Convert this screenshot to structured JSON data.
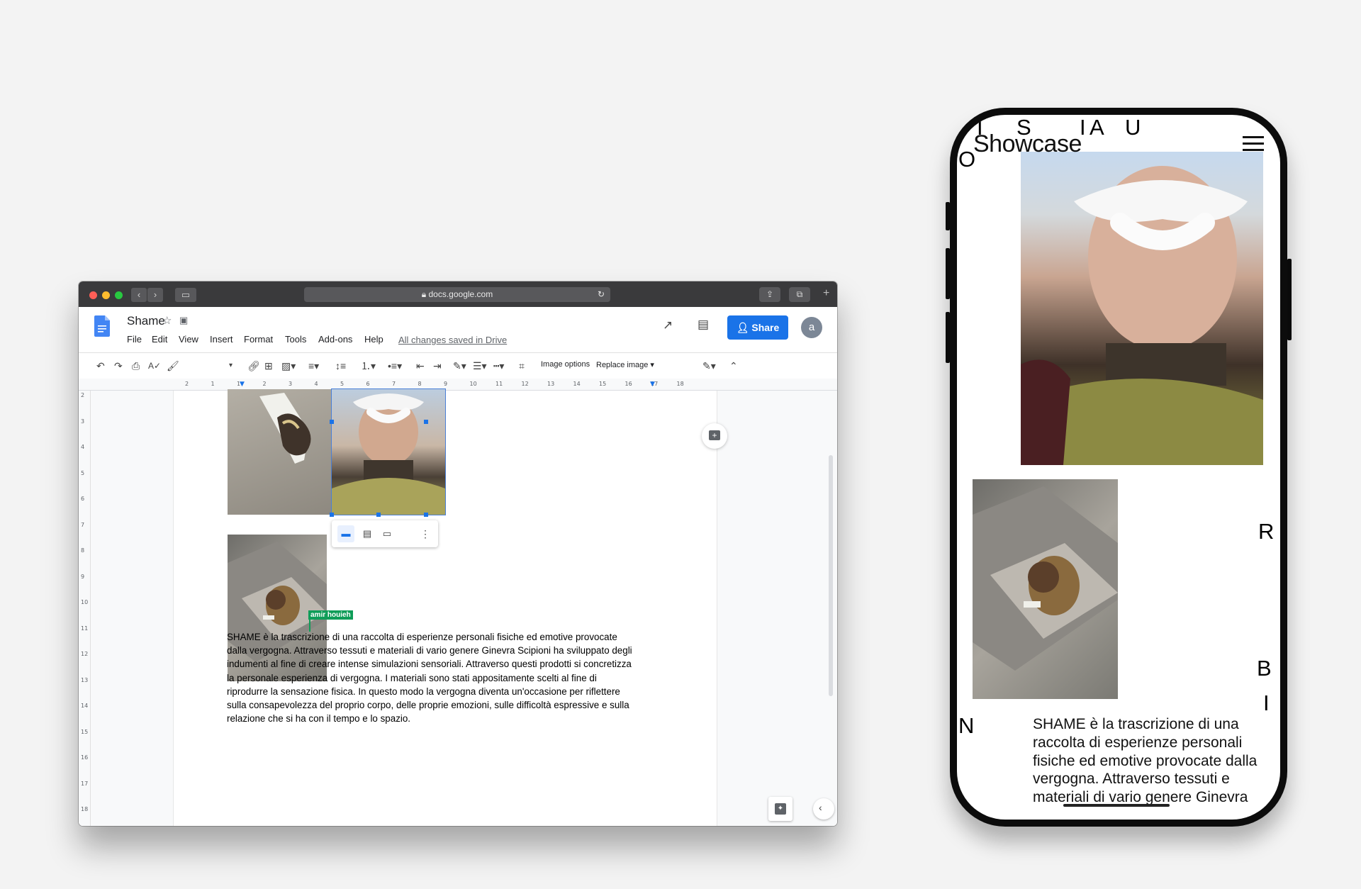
{
  "browser": {
    "url": "docs.google.com",
    "traffic_lights": [
      "#ff5f57",
      "#febc2e",
      "#28c840"
    ]
  },
  "docs": {
    "title": "Shame",
    "menu": [
      "File",
      "Edit",
      "View",
      "Insert",
      "Format",
      "Tools",
      "Add-ons",
      "Help"
    ],
    "saved_status": "All changes saved in Drive",
    "share_label": "Share",
    "avatar_letter": "a",
    "toolbar": {
      "image_options": "Image options",
      "replace_image": "Replace image"
    },
    "ruler_labels": [
      "2",
      "1",
      "1",
      "2",
      "3",
      "4",
      "5",
      "6",
      "7",
      "8",
      "9",
      "10",
      "11",
      "12",
      "13",
      "14",
      "15",
      "16",
      "17",
      "18"
    ],
    "vertical_ruler_labels": [
      "2",
      "3",
      "4",
      "5",
      "6",
      "7",
      "8",
      "9",
      "10",
      "11",
      "12",
      "13",
      "14",
      "15",
      "16",
      "17",
      "18"
    ],
    "cursor_user": "amir houieh",
    "paragraph": "SHAME è la trascrizione di una raccolta di esperienze personali fisiche ed emotive provocate dalla vergogna. Attraverso tessuti e materiali di vario genere Ginevra Scipioni ha sviluppato degli indumenti al fine di creare intense simulazioni sensoriali.  Attraverso questi prodotti si concretizza la personale esperienza di vergogna. I materiali sono stati appositamente scelti al fine di riprodurre la sensazione fisica. In questo modo la vergogna diventa un'occasione per riflettere sulla consapevolezza del proprio corpo, delle proprie emozioni, sulle difficoltà espressive e sulla relazione che si ha con il tempo e lo spazio.",
    "accent_color": "#1a73e8",
    "cursor_color": "#0f9d58"
  },
  "phone": {
    "brand": "Showcase",
    "scattered_letters": [
      "I",
      "S",
      "I",
      "A",
      "U",
      "O",
      "R",
      "B",
      "I",
      "N"
    ],
    "text": "SHAME è la trascrizione di una raccolta di esperienze personali fisiche ed emotive provocate dalla vergogna. Attraverso tessuti e materiali di vario genere Ginevra"
  }
}
